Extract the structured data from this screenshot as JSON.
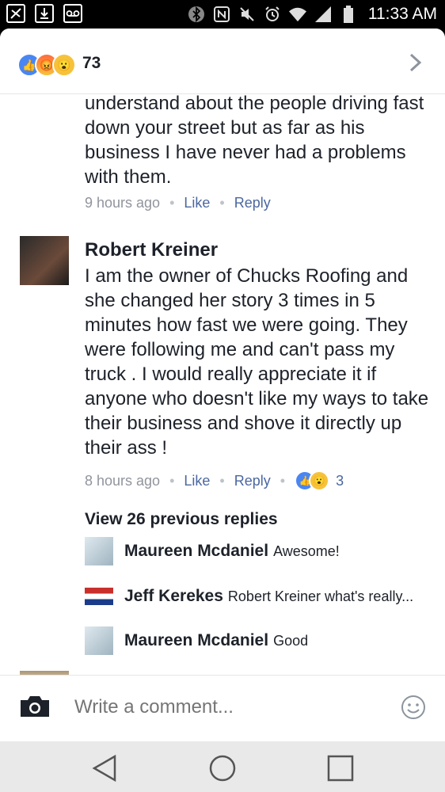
{
  "status_bar": {
    "time": "11:33 AM",
    "left_icons": [
      "runner-icon",
      "download-icon",
      "voicemail-icon"
    ],
    "right_icons": [
      "bluetooth-icon",
      "nfc-icon",
      "mute-icon",
      "alarm-icon",
      "wifi-icon",
      "signal-icon",
      "battery-icon"
    ]
  },
  "reactions_bar": {
    "count": "73",
    "icons": [
      "like-icon",
      "angry-icon",
      "wow-icon"
    ]
  },
  "previous_comment": {
    "text": "understand about the people driving fast down your street but as far as his business I have never had a problems with them.",
    "time": "9 hours ago",
    "like_label": "Like",
    "reply_label": "Reply"
  },
  "comment": {
    "author": "Robert Kreiner",
    "text": "I am the owner of  Chucks Roofing and she changed her story 3 times in 5 minutes how fast we were going. They were following me and can't pass my truck . I would really appreciate it if anyone who doesn't like my ways to take their business and shove it directly up their ass !",
    "time": "8 hours ago",
    "like_label": "Like",
    "reply_label": "Reply",
    "reaction_count": "3"
  },
  "replies": {
    "view_previous_label": "View 26 previous replies",
    "items": [
      {
        "name": "Maureen Mcdaniel",
        "text": "Awesome!"
      },
      {
        "name": "Jeff Kerekes",
        "text": "Robert Kreiner  what's really..."
      },
      {
        "name": "Maureen Mcdaniel",
        "text": "Good"
      }
    ]
  },
  "composer": {
    "placeholder": "Write a comment..."
  },
  "colors": {
    "link": "#4b67a1",
    "meta": "#90949c",
    "like_blue": "#4a86f2",
    "wow_yellow": "#f7c23b"
  }
}
